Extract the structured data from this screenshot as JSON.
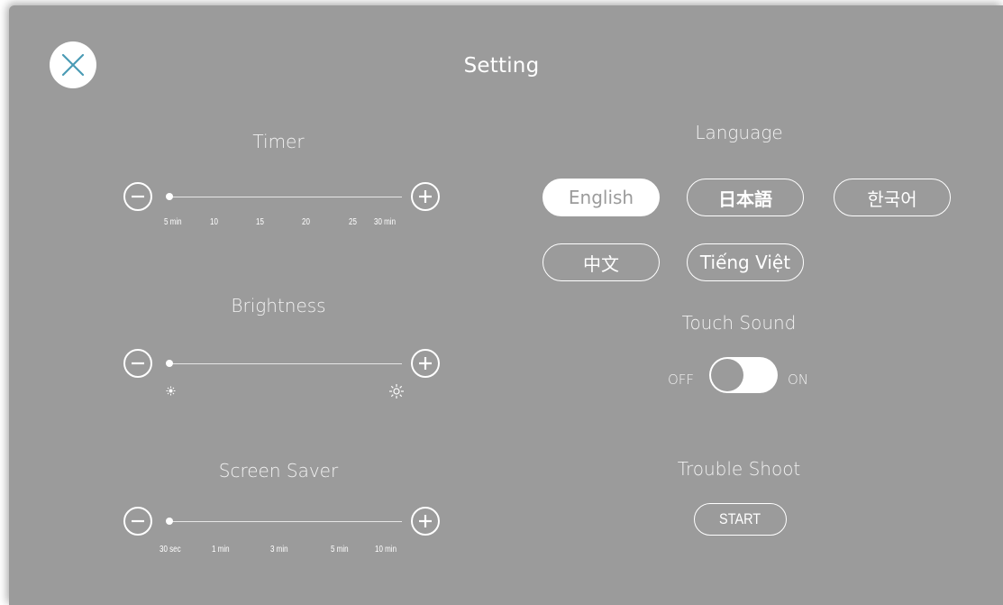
{
  "header": {
    "title": "Setting"
  },
  "timer": {
    "label": "Timer",
    "ticks": [
      "5 min",
      "10",
      "15",
      "20",
      "25",
      "30 min"
    ],
    "value": "5 min"
  },
  "brightness": {
    "label": "Brightness",
    "min_icon": "dim-sun-icon",
    "max_icon": "bright-sun-icon"
  },
  "screen_saver": {
    "label": "Screen Saver",
    "ticks": [
      "30 sec",
      "1 min",
      "3 min",
      "5 min",
      "10 min"
    ],
    "value": "30 sec"
  },
  "language": {
    "label": "Language",
    "options": [
      "English",
      "日本語",
      "한국어",
      "中文",
      "Tiếng Việt"
    ],
    "selected": "English"
  },
  "touch_sound": {
    "label": "Touch Sound",
    "off_label": "OFF",
    "on_label": "ON",
    "state": "ON"
  },
  "trouble_shoot": {
    "label": "Trouble Shoot",
    "button_label": "START"
  },
  "colors": {
    "background": "#9b9b9b",
    "foreground": "#ffffff",
    "close_icon": "#4a9bb5"
  }
}
